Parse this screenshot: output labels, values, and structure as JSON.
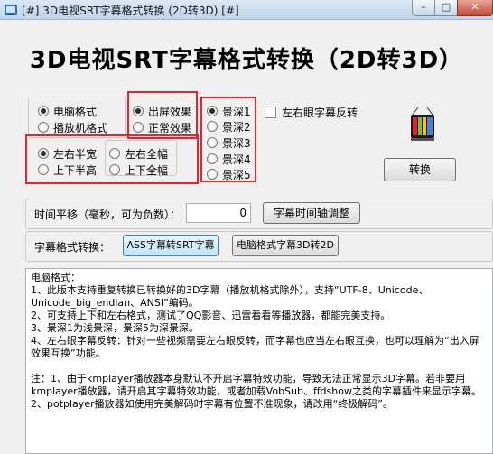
{
  "window": {
    "title": "[#] 3D电视SRT字幕格式转换 (2D转3D) [#]",
    "minimize": "–",
    "maximize": "□",
    "close": "✕"
  },
  "heading": "3D电视SRT字幕格式转换（2D转3D）",
  "format_group": {
    "pc": "电脑格式",
    "player": "播放机格式",
    "selected": "pc"
  },
  "screen_group": {
    "out": "出屏效果",
    "normal": "正常效果",
    "selected": "out"
  },
  "layout_group": {
    "lr_half": "左右半宽",
    "lr_full": "左右全幅",
    "tb_half": "上下半高",
    "tb_full": "上下全幅",
    "selected": "lr_half"
  },
  "depth_group": {
    "items": [
      "景深1",
      "景深2",
      "景深3",
      "景深4",
      "景深5"
    ],
    "selected": 0
  },
  "reverse_checkbox": {
    "label": "左右眼字幕反转",
    "checked": false
  },
  "convert_button": "转换",
  "time_shift": {
    "label": "时间平移（毫秒，可为负数）：",
    "value": "0",
    "button": "字幕时间轴调整"
  },
  "subtitle_convert": {
    "label": "字幕格式转换：",
    "ass_button": "ASS字幕转SRT字幕",
    "pc_button": "电脑格式字幕3D转2D"
  },
  "notes": "电脑格式：\n1、此版本支持重复转换已转换好的3D字幕（播放机格式除外），支持“UTF-8、Unicode、Unicode_big_endian、ANSI”编码。\n2、可支持上下和左右格式，测试了QQ影音、迅雷看看等播放器，都能完美支持。\n3、景深1为浅景深，景深5为深景深。\n4、左右眼字幕反转：针对一些视频需要左右眼反转，而字幕也应当左右眼互换，也可以理解为“出入屏效果互换”功能。\n\n注：1、由于kmplayer播放器本身默认不开启字幕特效功能，导致无法正常显示3D字幕。若非要用kmplayer播放器，请开启其字幕特效功能，或者加载VobSub、ffdshow之类的字幕插件来显示字幕。2、potplayer播放器如使用完美解码时字幕有位置不准现象，请改用“终极解码”。",
  "colors": {
    "highlight": "#e8232a",
    "title_gradient": "#bfd5ec",
    "close_button": "#c24b35"
  }
}
